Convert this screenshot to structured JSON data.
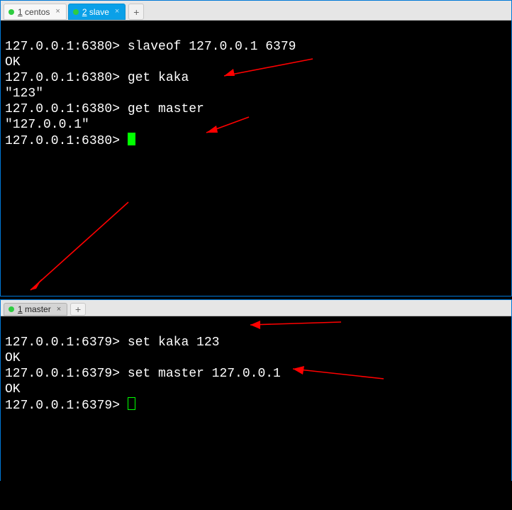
{
  "panes": {
    "top": {
      "tabs": [
        {
          "label_num": "1",
          "label_text": " centos",
          "active": false
        },
        {
          "label_num": "2",
          "label_text": " slave",
          "active": true
        }
      ],
      "lines": [
        {
          "prompt": "127.0.0.1:6380> ",
          "cmd": "slaveof 127.0.0.1 6379"
        },
        {
          "out": "OK"
        },
        {
          "prompt": "127.0.0.1:6380> ",
          "cmd": "get kaka"
        },
        {
          "out": "\"123\""
        },
        {
          "prompt": "127.0.0.1:6380> ",
          "cmd": "get master"
        },
        {
          "out": "\"127.0.0.1\""
        },
        {
          "prompt": "127.0.0.1:6380> ",
          "cursor": "block"
        }
      ]
    },
    "bottom": {
      "tabs": [
        {
          "label_num": "1",
          "label_text": " master",
          "active": true
        }
      ],
      "lines": [
        {
          "prompt": "127.0.0.1:6379> ",
          "cmd": "set kaka 123"
        },
        {
          "out": "OK"
        },
        {
          "prompt": "127.0.0.1:6379> ",
          "cmd": "set master 127.0.0.1"
        },
        {
          "out": "OK"
        },
        {
          "prompt": "127.0.0.1:6379> ",
          "cursor": "outline"
        }
      ]
    }
  },
  "glyphs": {
    "close_x": "×",
    "plus": "+"
  }
}
